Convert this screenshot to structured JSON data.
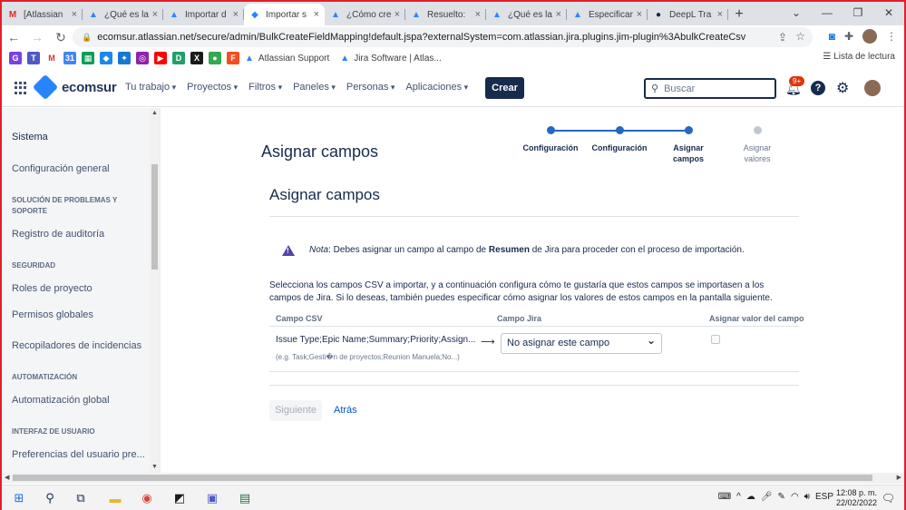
{
  "browser": {
    "tabs": [
      {
        "title": "[Atlassian",
        "icon": "gmail-icon",
        "color": "#d93025",
        "glyph": "M"
      },
      {
        "title": "¿Qué es la",
        "icon": "atlassian-icon",
        "color": "#2684ff",
        "glyph": "▲"
      },
      {
        "title": "Importar d",
        "icon": "atlassian-icon",
        "color": "#2684ff",
        "glyph": "▲"
      },
      {
        "title": "Importar s",
        "icon": "jira-icon",
        "color": "#2684ff",
        "glyph": "◆",
        "active": true
      },
      {
        "title": "¿Cómo cre",
        "icon": "atlassian-icon",
        "color": "#2684ff",
        "glyph": "▲"
      },
      {
        "title": "Resuelto: ",
        "icon": "atlassian-icon",
        "color": "#2684ff",
        "glyph": "▲"
      },
      {
        "title": "¿Qué es la",
        "icon": "atlassian-icon",
        "color": "#2684ff",
        "glyph": "▲"
      },
      {
        "title": "Especificar",
        "icon": "atlassian-icon",
        "color": "#2684ff",
        "glyph": "▲"
      },
      {
        "title": "DeepL Tra",
        "icon": "deepl-icon",
        "color": "#0f2b46",
        "glyph": "●"
      }
    ],
    "url": "ecomsur.atlassian.net/secure/admin/BulkCreateFieldMapping!default.jspa?externalSystem=com.atlassian.jira.plugins.jim-plugin%3AbulkCreateCsv",
    "bookmarks": [
      {
        "label": "Atlassian Support",
        "icon": "atlassian-icon"
      },
      {
        "label": "Jira Software | Atlas...",
        "icon": "atlassian-icon"
      }
    ],
    "reading_list": "Lista de lectura"
  },
  "header": {
    "logo": "ecomsur",
    "nav": [
      "Tu trabajo",
      "Proyectos",
      "Filtros",
      "Paneles",
      "Personas",
      "Aplicaciones"
    ],
    "create_label": "Crear",
    "search_placeholder": "Buscar",
    "notif_badge": "9+"
  },
  "sidebar": {
    "title": "Sistema",
    "items": [
      {
        "type": "item",
        "label": "Configuración general"
      },
      {
        "type": "section",
        "label": "SOLUCIÓN DE PROBLEMAS Y SOPORTE"
      },
      {
        "type": "item",
        "label": "Registro de auditoría"
      },
      {
        "type": "section",
        "label": "SEGURIDAD"
      },
      {
        "type": "item",
        "label": "Roles de proyecto"
      },
      {
        "type": "item",
        "label": "Permisos globales"
      },
      {
        "type": "item",
        "label": "Recopiladores de incidencias"
      },
      {
        "type": "section",
        "label": "AUTOMATIZACIÓN"
      },
      {
        "type": "item",
        "label": "Automatización global"
      },
      {
        "type": "section",
        "label": "INTERFAZ DE USUARIO"
      },
      {
        "type": "item",
        "label": "Preferencias del usuario pre..."
      }
    ]
  },
  "main": {
    "page_title": "Asignar campos",
    "section_title": "Asignar campos",
    "steps": [
      {
        "label": "Configuración",
        "done": true
      },
      {
        "label": "Configuración",
        "done": true
      },
      {
        "label": "Asignar campos",
        "done": true
      },
      {
        "label": "Asignar valores",
        "done": false
      }
    ],
    "note_prefix": "Nota",
    "note_text_1": ": Debes asignar un campo al campo de ",
    "note_bold": "Resumen",
    "note_text_2": " de Jira para proceder con el proceso de importación.",
    "description": "Selecciona los campos CSV a importar, y a continuación configura cómo te gustaría que estos campos se importasen a los campos de Jira. Si lo deseas, también puedes especificar cómo asignar los valores de estos campos en la pantalla siguiente.",
    "table": {
      "headers": [
        "Campo CSV",
        "Campo Jira",
        "Asignar valor del campo"
      ],
      "rows": [
        {
          "csv_field": "Issue Type;Epic Name;Summary;Priority;Assign...",
          "example": "(e.g. Task;Gesti�n de proyectos;Reunion Manuela;No...)",
          "arrow": "⟶",
          "jira_field": "No asignar este campo",
          "map_value": false
        }
      ]
    },
    "next_label": "Siguiente",
    "back_label": "Atrás"
  },
  "taskbar": {
    "lang": "ESP",
    "time": "12:08 p. m.",
    "date": "22/02/2022"
  },
  "colors": {
    "accent": "#2567c2",
    "link": "#0052cc",
    "primary_dark": "#172b4d",
    "frame_red": "#e0202a"
  }
}
